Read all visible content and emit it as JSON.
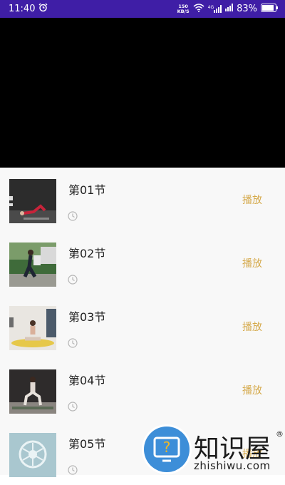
{
  "status_bar": {
    "time": "11:40",
    "net_speed_value": "150",
    "net_speed_unit": "KB/S",
    "signal1_label": "4G",
    "battery": "83%"
  },
  "lessons": [
    {
      "title": "第01节",
      "play_label": "播放",
      "thumb": "thumb-floor-exercise"
    },
    {
      "title": "第02节",
      "play_label": "播放",
      "thumb": "thumb-outdoor-walk"
    },
    {
      "title": "第03节",
      "play_label": "播放",
      "thumb": "thumb-seated-yoga"
    },
    {
      "title": "第04节",
      "play_label": "播放",
      "thumb": "thumb-squat"
    },
    {
      "title": "第05节",
      "play_label": "播放",
      "thumb": "thumb-logo"
    }
  ],
  "watermark": {
    "name": "知识屋",
    "registered": "®",
    "url": "zhishiwu.com"
  },
  "colors": {
    "status_bar": "#3f1ea6",
    "play_accent": "#d5a94a",
    "list_bg": "#f8f8f8",
    "video_bg": "#000000",
    "watermark_blue": "#3d8ed8"
  }
}
